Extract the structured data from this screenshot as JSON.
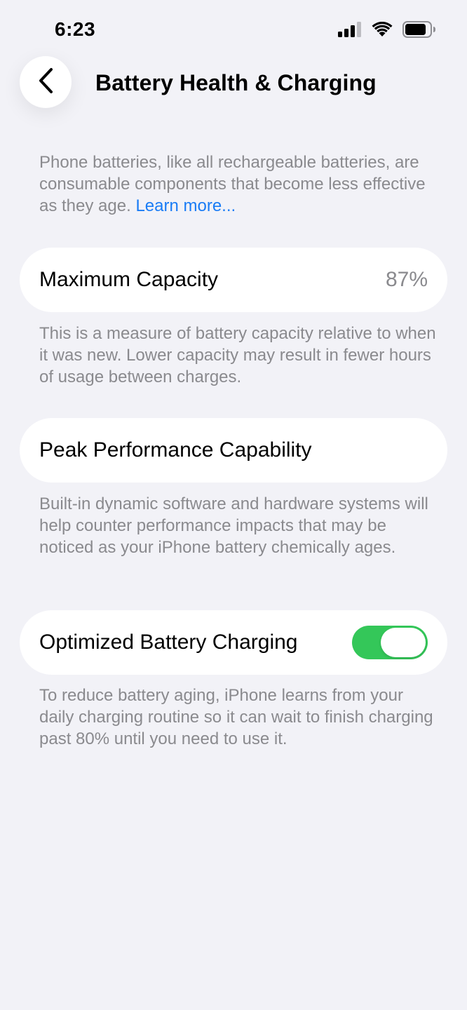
{
  "status_bar": {
    "time": "6:23"
  },
  "icons": {
    "signal": "cellular-signal-icon",
    "wifi": "wifi-icon",
    "battery": "battery-icon",
    "back": "chevron-left-icon"
  },
  "colors": {
    "background": "#f2f2f7",
    "link": "#1a7cf5",
    "toggle_on": "#34c759",
    "secondary_text": "#8a8a8e"
  },
  "nav": {
    "title": "Battery Health & Charging"
  },
  "intro": {
    "text": "Phone batteries, like all rechargeable batteries, are consumable components that become less effective as they age. ",
    "link": "Learn more..."
  },
  "max_capacity": {
    "label": "Maximum Capacity",
    "value": "87%",
    "description": "This is a measure of battery capacity relative to when it was new. Lower capacity may result in fewer hours of usage between charges."
  },
  "peak_performance": {
    "label": "Peak Performance Capability",
    "description": "Built-in dynamic software and hardware systems will help counter performance impacts that may be noticed as your iPhone battery chemically ages."
  },
  "optimized_charging": {
    "label": "Optimized Battery Charging",
    "enabled": true,
    "description": "To reduce battery aging, iPhone learns from your daily charging routine so it can wait to finish charging past 80% until you need to use it."
  }
}
